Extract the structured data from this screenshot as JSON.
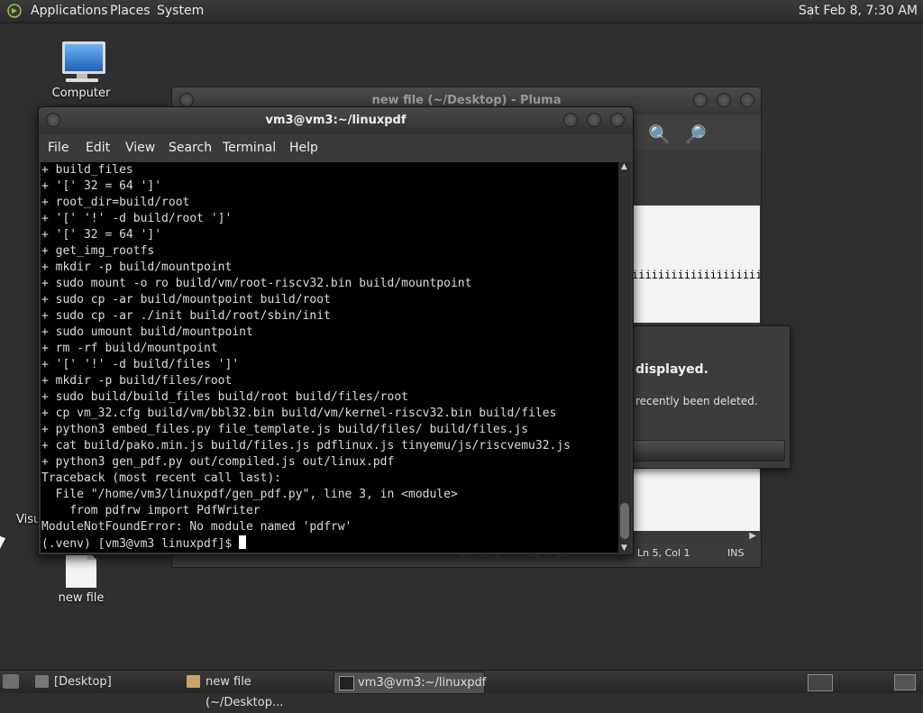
{
  "top_panel": {
    "menus": [
      "Applications",
      "Places",
      "System"
    ],
    "clock": "Sat Feb  8,  7:30 AM"
  },
  "desktop": {
    "icons": [
      {
        "label": "Computer",
        "icon": "computer-icon"
      },
      {
        "label": "new file",
        "icon": "text-file-icon"
      },
      {
        "label": "Visu",
        "icon": "folder-icon"
      }
    ]
  },
  "pluma": {
    "title": "new file (~/Desktop) - Pluma",
    "doc_text": "iiiiiiiiiiiiiiiiiiiiii",
    "status": {
      "syntax": "Plain Text",
      "tab_width": "Tab Width:  4",
      "position": "Ln 5, Col 1",
      "mode": "INS"
    }
  },
  "dialog": {
    "primary_text": "displayed.",
    "secondary_text": "recently been deleted."
  },
  "terminal": {
    "title": "vm3@vm3:~/linuxpdf",
    "menu": [
      "File",
      "Edit",
      "View",
      "Search",
      "Terminal",
      "Help"
    ],
    "lines": [
      "+ build_files",
      "+ '[' 32 = 64 ']'",
      "+ root_dir=build/root",
      "+ '[' '!' -d build/root ']'",
      "+ '[' 32 = 64 ']'",
      "+ get_img_rootfs",
      "+ mkdir -p build/mountpoint",
      "+ sudo mount -o ro build/vm/root-riscv32.bin build/mountpoint",
      "+ sudo cp -ar build/mountpoint build/root",
      "+ sudo cp -ar ./init build/root/sbin/init",
      "+ sudo umount build/mountpoint",
      "+ rm -rf build/mountpoint",
      "+ '[' '!' -d build/files ']'",
      "+ mkdir -p build/files/root",
      "+ sudo build/build_files build/root build/files/root",
      "+ cp vm_32.cfg build/vm/bbl32.bin build/vm/kernel-riscv32.bin build/files",
      "+ python3 embed_files.py file_template.js build/files/ build/files.js",
      "+ cat build/pako.min.js build/files.js pdflinux.js tinyemu/js/riscvemu32.js",
      "+ python3 gen_pdf.py out/compiled.js out/linux.pdf",
      "Traceback (most recent call last):",
      "  File \"/home/vm3/linuxpdf/gen_pdf.py\", line 3, in <module>",
      "    from pdfrw import PdfWriter",
      "ModuleNotFoundError: No module named 'pdfrw'"
    ],
    "prompt": "(.venv) [vm3@vm3 linuxpdf]$ "
  },
  "taskbar": {
    "tasks": [
      {
        "label": "[Desktop]",
        "icon": "folder-icon",
        "active": false
      },
      {
        "label": "new file (~/Desktop...",
        "icon": "text-editor-icon",
        "active": false
      },
      {
        "label": "vm3@vm3:~/linuxpdf",
        "icon": "terminal-icon",
        "active": true
      }
    ]
  },
  "colors": {
    "terminal_bg": "#000000",
    "terminal_fg": "#dcdcdc",
    "panel_bg": "#2a2a2a",
    "desktop_bg": "#2f2f2f"
  }
}
